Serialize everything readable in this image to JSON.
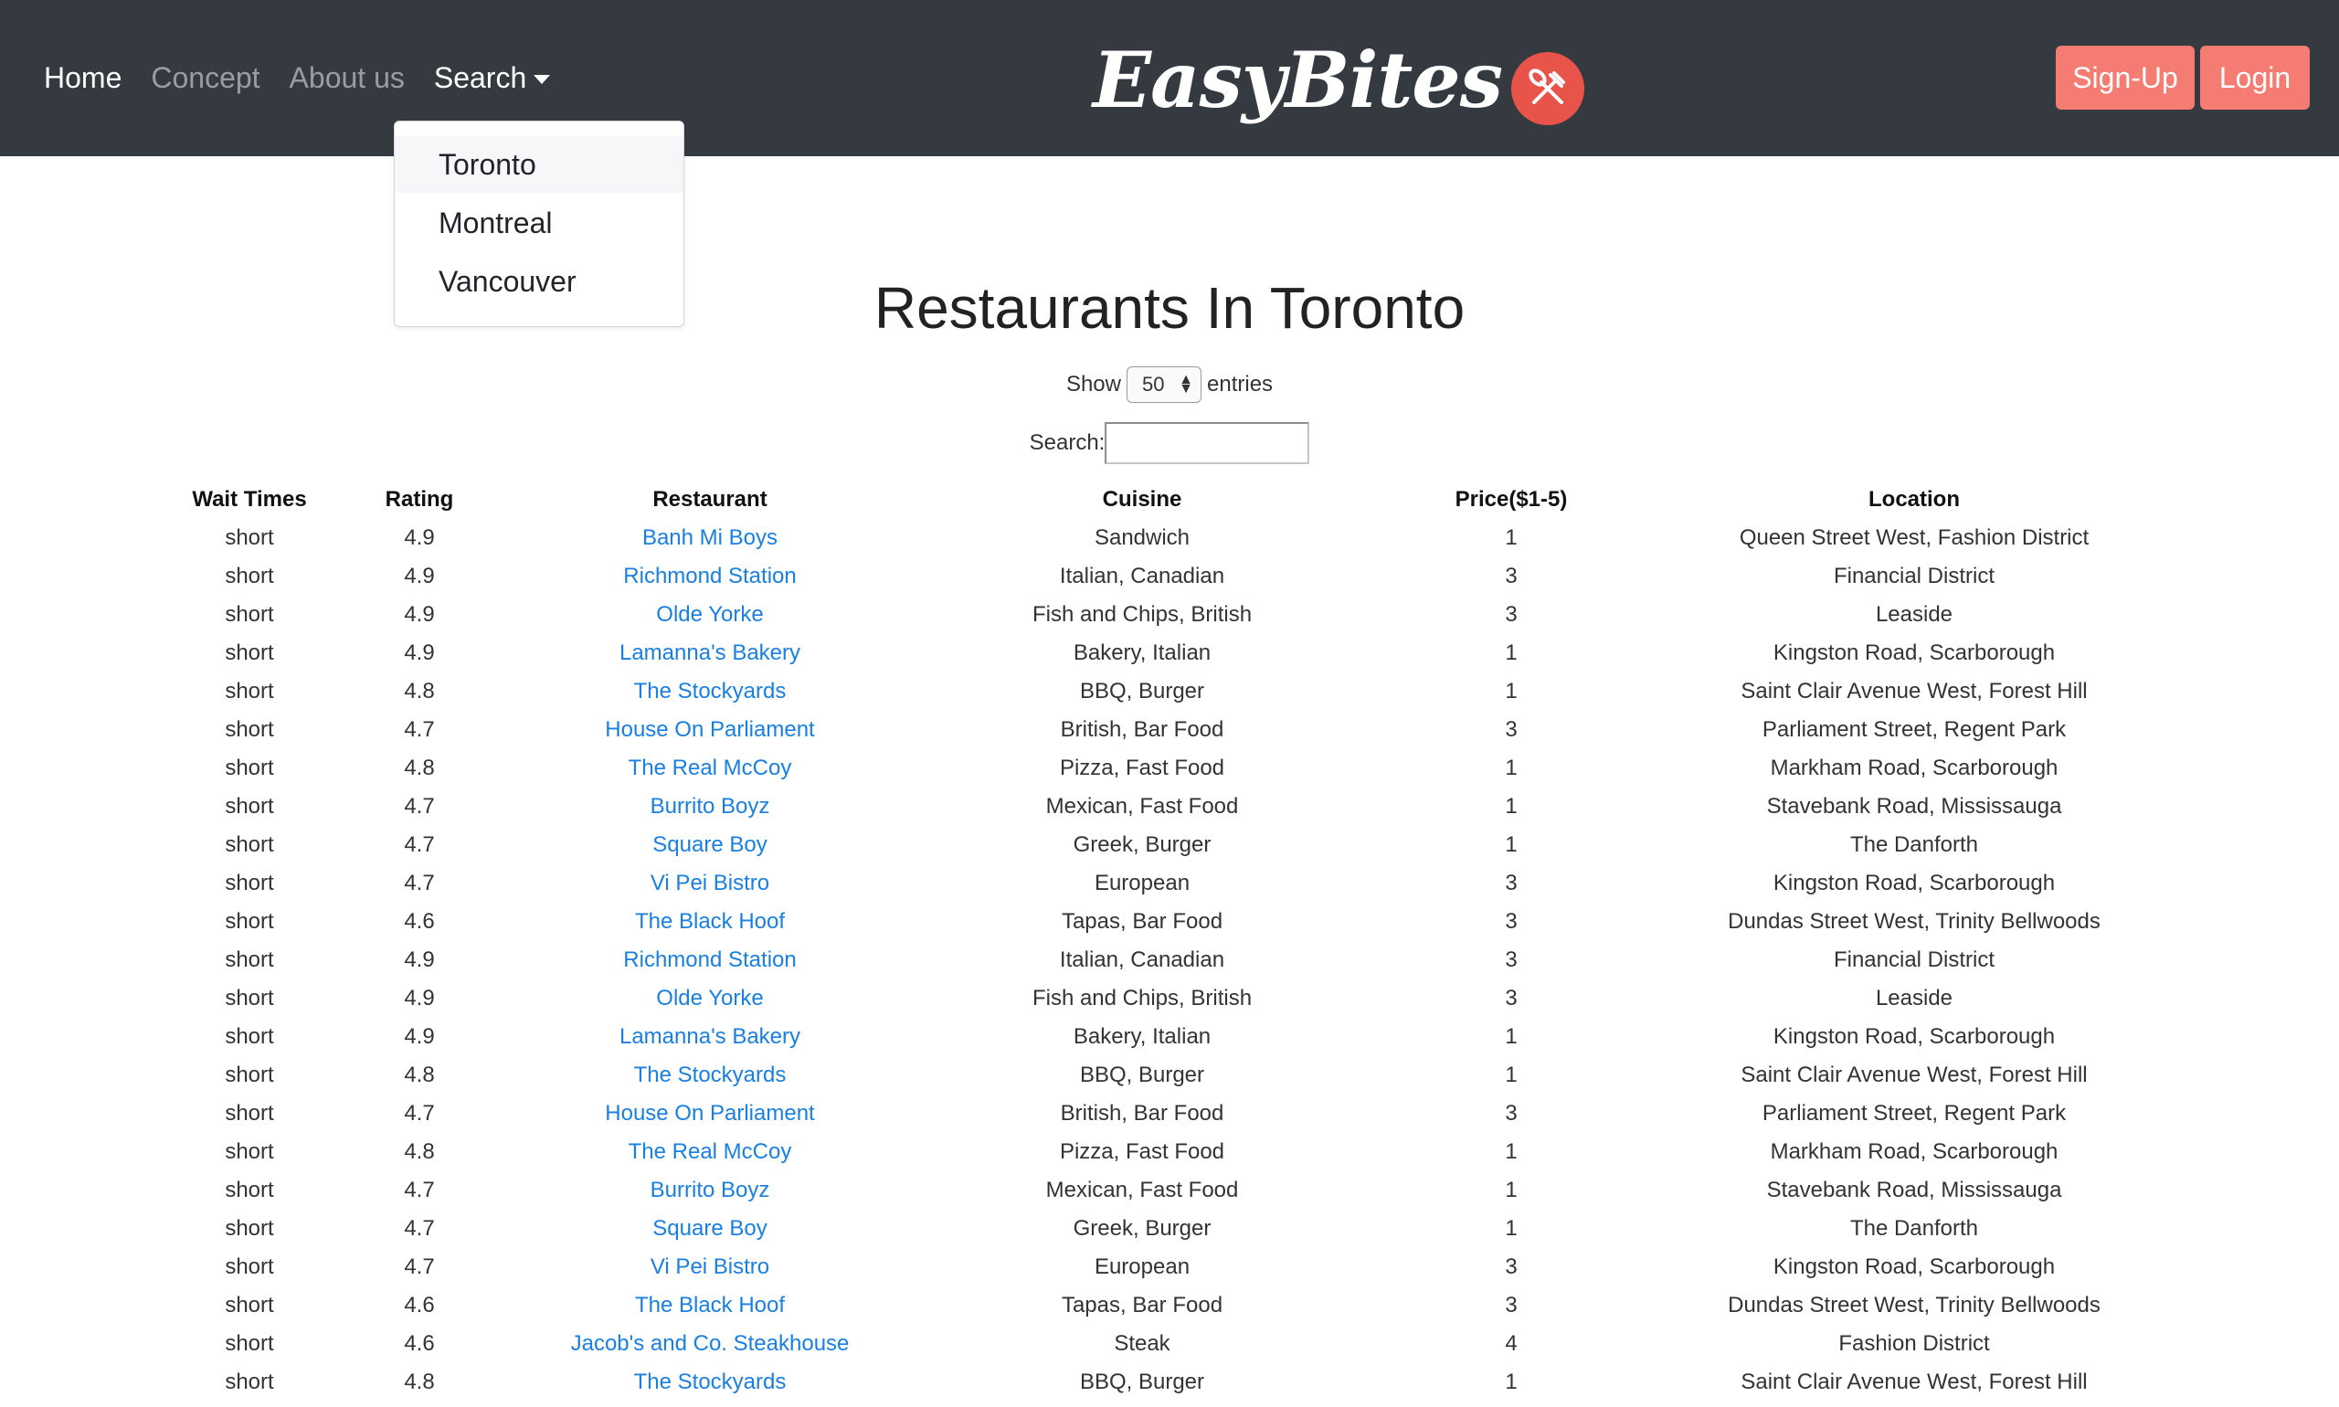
{
  "nav": {
    "links": [
      "Home",
      "Concept",
      "About us"
    ],
    "search_label": "Search",
    "brand": "EasyBites",
    "signup": "Sign-Up",
    "login": "Login"
  },
  "dropdown": {
    "items": [
      "Toronto",
      "Montreal",
      "Vancouver"
    ]
  },
  "title": "Restaurants In Toronto",
  "controls": {
    "show_label": "Show",
    "entries_value": "50",
    "entries_label": "entries",
    "search_label": "Search:",
    "search_value": ""
  },
  "table": {
    "headers": [
      "Wait Times",
      "Rating",
      "Restaurant",
      "Cuisine",
      "Price($1-5)",
      "Location"
    ],
    "rows": [
      [
        "short",
        "4.9",
        "Banh Mi Boys",
        "Sandwich",
        "1",
        "Queen Street West, Fashion District"
      ],
      [
        "short",
        "4.9",
        "Richmond Station",
        "Italian, Canadian",
        "3",
        "Financial District"
      ],
      [
        "short",
        "4.9",
        "Olde Yorke",
        "Fish and Chips, British",
        "3",
        "Leaside"
      ],
      [
        "short",
        "4.9",
        "Lamanna's Bakery",
        "Bakery, Italian",
        "1",
        "Kingston Road, Scarborough"
      ],
      [
        "short",
        "4.8",
        "The Stockyards",
        "BBQ, Burger",
        "1",
        "Saint Clair Avenue West, Forest Hill"
      ],
      [
        "short",
        "4.7",
        "House On Parliament",
        "British, Bar Food",
        "3",
        "Parliament Street, Regent Park"
      ],
      [
        "short",
        "4.8",
        "The Real McCoy",
        "Pizza, Fast Food",
        "1",
        "Markham Road, Scarborough"
      ],
      [
        "short",
        "4.7",
        "Burrito Boyz",
        "Mexican, Fast Food",
        "1",
        "Stavebank Road, Mississauga"
      ],
      [
        "short",
        "4.7",
        "Square Boy",
        "Greek, Burger",
        "1",
        "The Danforth"
      ],
      [
        "short",
        "4.7",
        "Vi Pei Bistro",
        "European",
        "3",
        "Kingston Road, Scarborough"
      ],
      [
        "short",
        "4.6",
        "The Black Hoof",
        "Tapas, Bar Food",
        "3",
        "Dundas Street West, Trinity Bellwoods"
      ],
      [
        "short",
        "4.9",
        "Richmond Station",
        "Italian, Canadian",
        "3",
        "Financial District"
      ],
      [
        "short",
        "4.9",
        "Olde Yorke",
        "Fish and Chips, British",
        "3",
        "Leaside"
      ],
      [
        "short",
        "4.9",
        "Lamanna's Bakery",
        "Bakery, Italian",
        "1",
        "Kingston Road, Scarborough"
      ],
      [
        "short",
        "4.8",
        "The Stockyards",
        "BBQ, Burger",
        "1",
        "Saint Clair Avenue West, Forest Hill"
      ],
      [
        "short",
        "4.7",
        "House On Parliament",
        "British, Bar Food",
        "3",
        "Parliament Street, Regent Park"
      ],
      [
        "short",
        "4.8",
        "The Real McCoy",
        "Pizza, Fast Food",
        "1",
        "Markham Road, Scarborough"
      ],
      [
        "short",
        "4.7",
        "Burrito Boyz",
        "Mexican, Fast Food",
        "1",
        "Stavebank Road, Mississauga"
      ],
      [
        "short",
        "4.7",
        "Square Boy",
        "Greek, Burger",
        "1",
        "The Danforth"
      ],
      [
        "short",
        "4.7",
        "Vi Pei Bistro",
        "European",
        "3",
        "Kingston Road, Scarborough"
      ],
      [
        "short",
        "4.6",
        "The Black Hoof",
        "Tapas, Bar Food",
        "3",
        "Dundas Street West, Trinity Bellwoods"
      ],
      [
        "short",
        "4.6",
        "Jacob's and Co. Steakhouse",
        "Steak",
        "4",
        "Fashion District"
      ],
      [
        "short",
        "4.8",
        "The Stockyards",
        "BBQ, Burger",
        "1",
        "Saint Clair Avenue West, Forest Hill"
      ]
    ]
  }
}
